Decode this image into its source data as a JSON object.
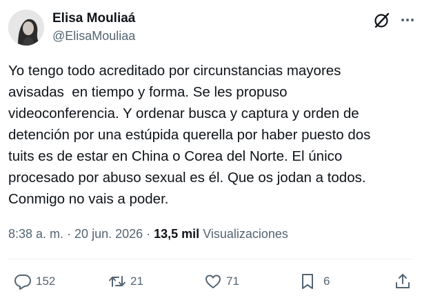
{
  "author": {
    "name": "Elisa Mouliaá",
    "handle": "@ElisaMouliaa"
  },
  "tweet": {
    "text": "Yo tengo todo acreditado por circunstancias mayores\navisadas  en tiempo y forma. Se les propuso\nvideoconferencia. Y ordenar busca y captura y orden de\ndetención por una estúpida querella por haber puesto dos\ntuits es de estar en China o Corea del Norte. El único\nprocesado por abuso sexual es él. Que os jodan a todos.\nConmigo no vais a poder."
  },
  "meta": {
    "time": "8:38 a. m.",
    "sep1": " · ",
    "date": "20 jun. 2026",
    "sep2": " · ",
    "views_count": "13,5 mil",
    "views_label": " Visualizaciones"
  },
  "actions": {
    "replies": "152",
    "reposts": "21",
    "likes": "71",
    "bookmarks": "6"
  },
  "icons": {
    "grok": "grok-icon",
    "more": "more-icon",
    "reply": "reply-icon",
    "repost": "repost-icon",
    "like": "heart-icon",
    "bookmark": "bookmark-icon",
    "share": "share-icon"
  },
  "colors": {
    "text": "#0f1419",
    "secondary": "#536471",
    "divider": "#eff3f4"
  }
}
